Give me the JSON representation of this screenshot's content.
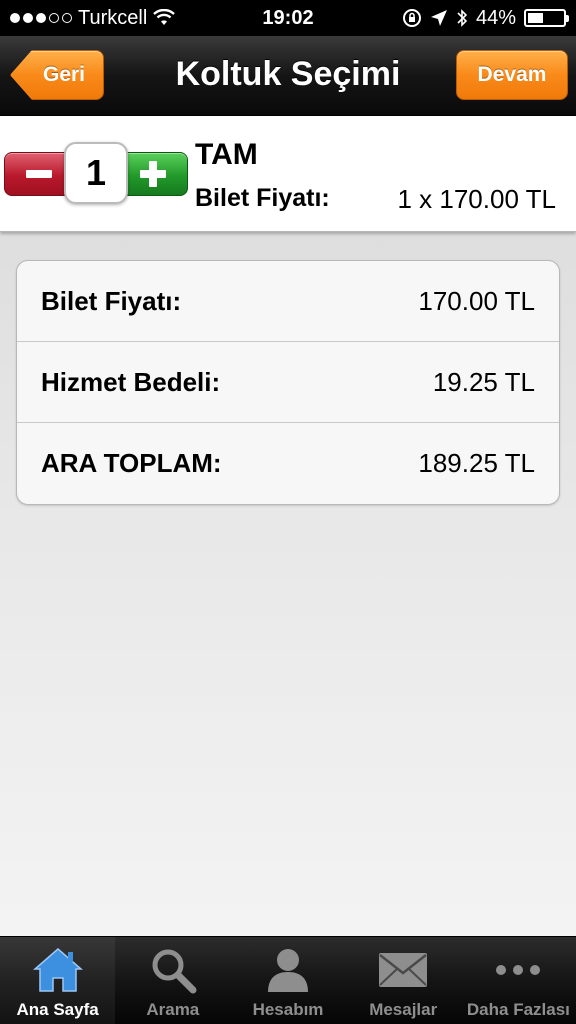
{
  "status_bar": {
    "carrier": "Turkcell",
    "time": "19:02",
    "battery": "44%",
    "battery_level": 0.44
  },
  "nav": {
    "title": "Koltuk Seçimi",
    "back_label": "Geri",
    "next_label": "Devam"
  },
  "ticket": {
    "quantity": "1",
    "type": "TAM",
    "price_label": "Bilet Fiyatı:",
    "price_value": "1 x 170.00 TL"
  },
  "summary": {
    "rows": [
      {
        "label": "Bilet Fiyatı:",
        "value": "170.00 TL"
      },
      {
        "label": "Hizmet Bedeli:",
        "value": "19.25 TL"
      },
      {
        "label": "ARA TOPLAM:",
        "value": "189.25 TL"
      }
    ]
  },
  "tabs": [
    {
      "label": "Ana Sayfa",
      "icon": "home-icon"
    },
    {
      "label": "Arama",
      "icon": "search-icon"
    },
    {
      "label": "Hesabım",
      "icon": "user-icon"
    },
    {
      "label": "Mesajlar",
      "icon": "envelope-icon"
    },
    {
      "label": "Daha Fazlası",
      "icon": "more-icon"
    }
  ],
  "colors": {
    "accent_orange": "#f98a1a",
    "minus_red": "#b8192b",
    "plus_green": "#22992a",
    "active_tab_blue": "#3d8fe0"
  }
}
